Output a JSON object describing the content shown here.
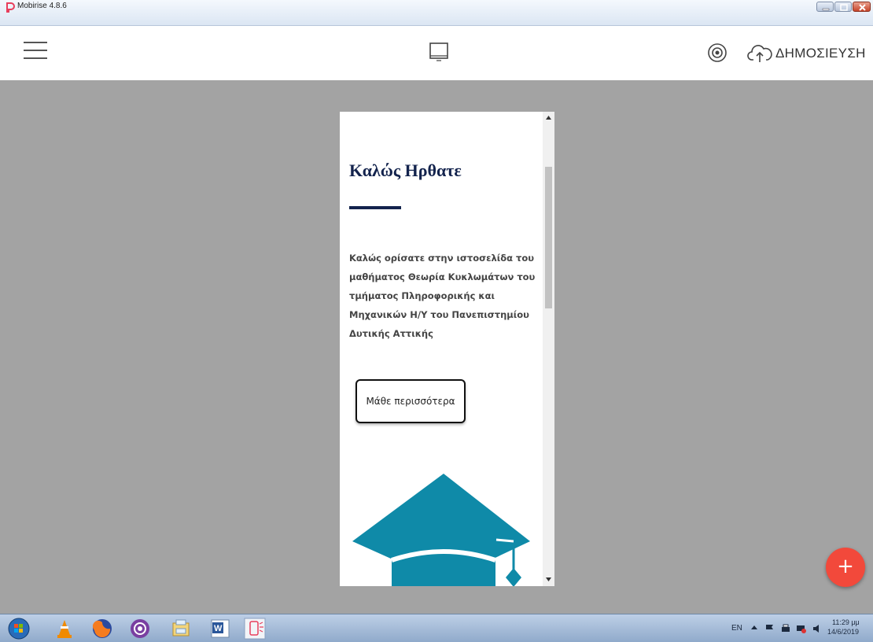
{
  "window": {
    "title": "Mobirise 4.8.6",
    "icon": "mobirise-icon",
    "controls": [
      "minimize-icon",
      "maximize-icon",
      "close-icon"
    ]
  },
  "toolbar": {
    "menu_icon": "hamburger-icon",
    "device_icon": "desktop-monitor-icon",
    "preview_icon": "eye-icon",
    "publish_icon": "cloud-upload-icon",
    "publish_label": "ΔΗΜΟΣΙΕΥΣΗ"
  },
  "preview": {
    "heading": "Καλώς Ηρθατε",
    "text": "Καλώς ορίσατε στην ιστοσελίδα του μαθήματος Θεωρία Κυκλωμάτων του τμήματος Πληροφορικής και Μηχανικών Η/Υ του Πανεπιστημίου Δυτικής Αττικής",
    "button_label": "Μάθε περισσότερα",
    "image_icon": "graduation-cap-icon",
    "colors": {
      "heading": "#13234d",
      "cap": "#0f8aa8"
    }
  },
  "fab": {
    "icon": "plus-icon",
    "label": "+",
    "color": "#f2493b"
  },
  "taskbar": {
    "apps": [
      "windows-start-icon",
      "vlc-icon",
      "firefox-icon",
      "tor-browser-icon",
      "file-explorer-icon",
      "word-icon",
      "mobirise-icon"
    ],
    "tray": {
      "language": "EN",
      "time": "11:29 μμ",
      "date": "14/6/2019"
    }
  }
}
